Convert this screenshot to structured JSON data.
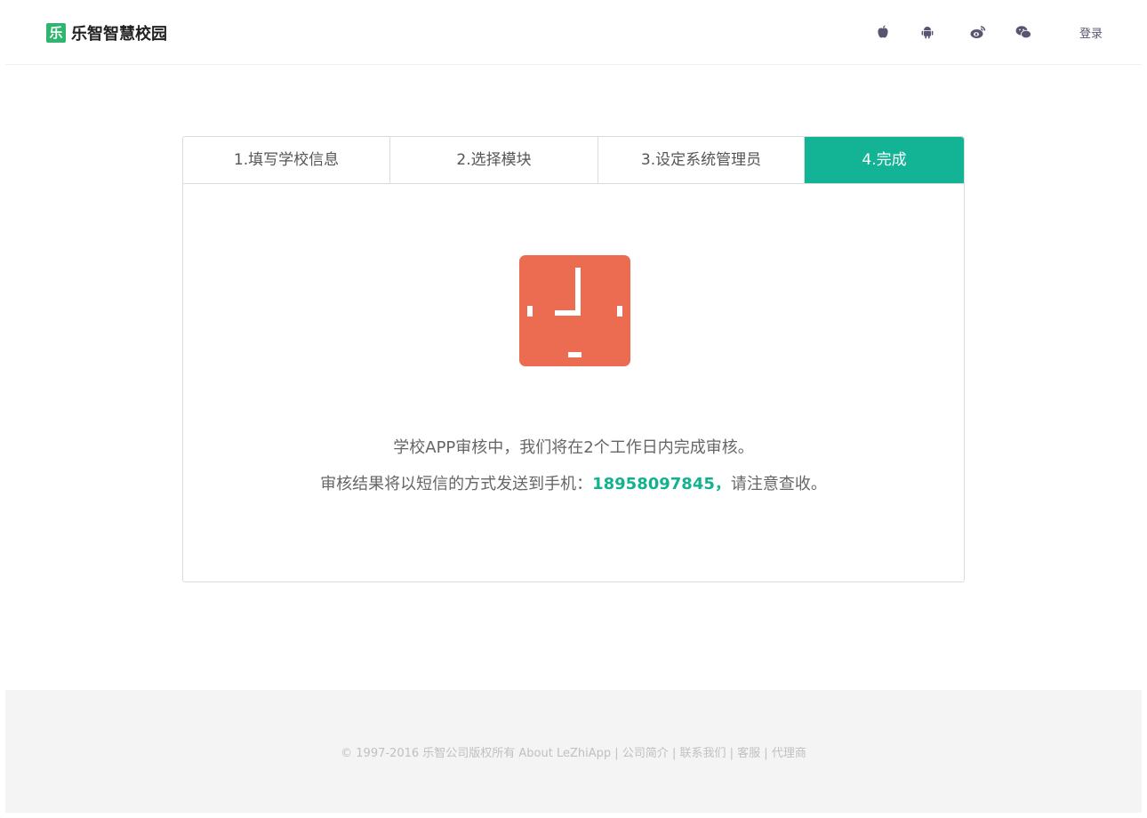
{
  "header": {
    "brand_logo_char": "乐",
    "brand_name": "乐智智慧校园",
    "icons": [
      "apple-icon",
      "android-icon",
      "weibo-icon",
      "wechat-icon"
    ],
    "login_label": "登录"
  },
  "steps": [
    {
      "label": "1.填写学校信息",
      "active": false
    },
    {
      "label": "2.选择模块",
      "active": false
    },
    {
      "label": "3.设定系统管理员",
      "active": false
    },
    {
      "label": "4.完成",
      "active": true
    }
  ],
  "status": {
    "icon": "clock-icon",
    "line1": "学校APP审核中，我们将在2个工作日内完成审核。",
    "line2_prefix": "审核结果将以短信的方式发送到手机：",
    "phone": "18958097845，",
    "line2_suffix": "请注意查收。"
  },
  "footer": {
    "copyright": "© 1997-2016 乐智公司版权所有 About LeZhiApp",
    "links": [
      "公司简介",
      "联系我们",
      "客服",
      "代理商"
    ],
    "separator": " | "
  },
  "colors": {
    "accent": "#12b495",
    "status_icon": "#ec6c52",
    "phone": "#13b28f",
    "footer_bg": "#f4f4f4"
  }
}
